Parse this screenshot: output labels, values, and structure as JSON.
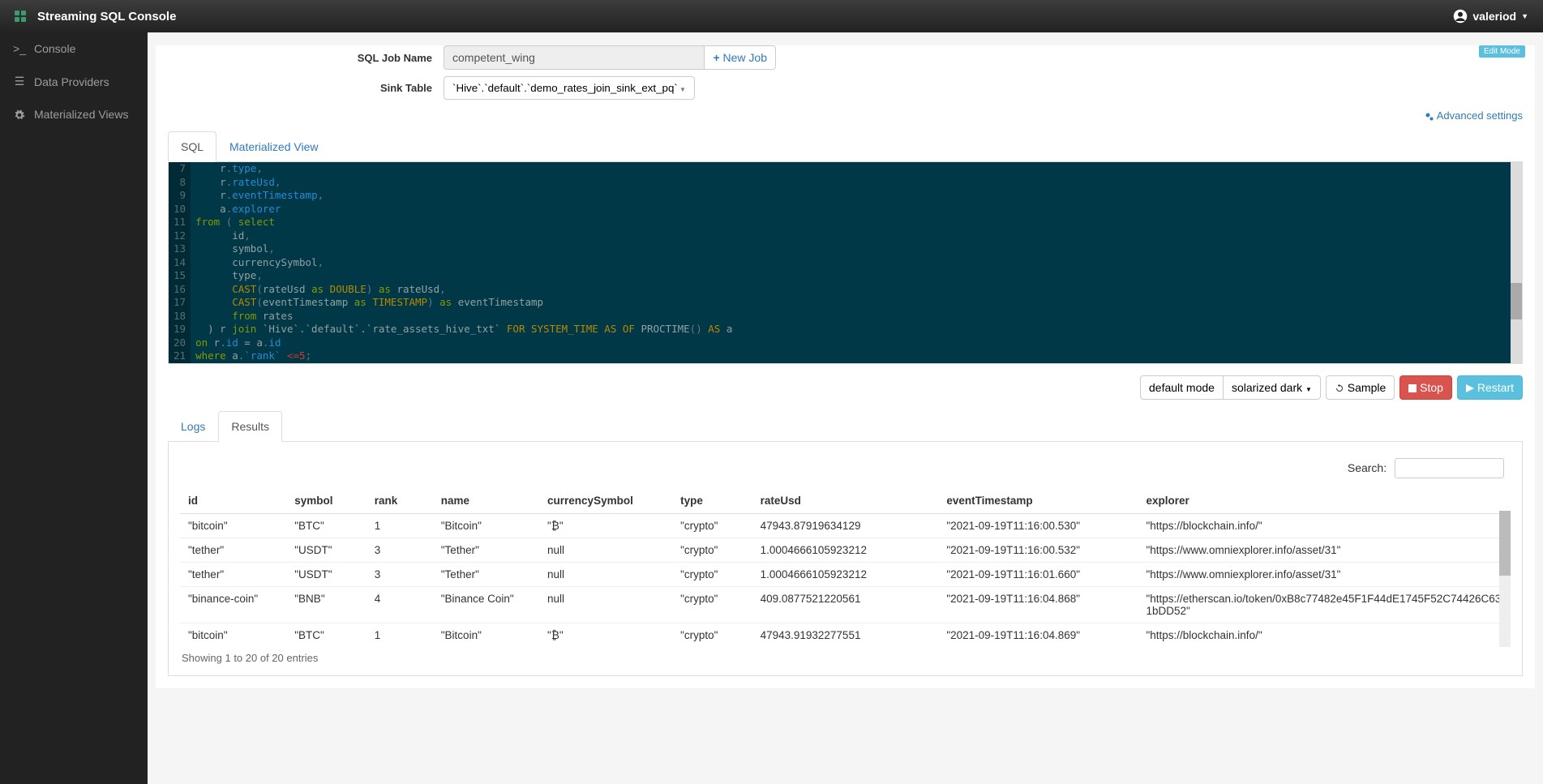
{
  "app": {
    "title": "Streaming SQL Console"
  },
  "user": {
    "name": "valeriod"
  },
  "sidebar": {
    "items": [
      {
        "label": "Console"
      },
      {
        "label": "Data Providers"
      },
      {
        "label": "Materialized Views"
      }
    ]
  },
  "panel": {
    "editModeLabel": "Edit Mode",
    "jobNameLabel": "SQL Job Name",
    "jobNameValue": "competent_wing",
    "newJobLabel": " New Job",
    "sinkTableLabel": "Sink Table",
    "sinkTableValue": "`Hive`.`default`.`demo_rates_join_sink_ext_pq`",
    "advancedLabel": " Advanced settings"
  },
  "tabs1": {
    "sql": "SQL",
    "mv": "Materialized View"
  },
  "editor": {
    "startLine": 7,
    "lines": [
      {
        "tokens": [
          [
            "    r",
            "ident"
          ],
          [
            ".",
            "punct"
          ],
          [
            "type",
            "fn"
          ],
          [
            ",",
            "punct"
          ]
        ]
      },
      {
        "tokens": [
          [
            "    r",
            "ident"
          ],
          [
            ".",
            "punct"
          ],
          [
            "rateUsd",
            "fn"
          ],
          [
            ",",
            "punct"
          ]
        ]
      },
      {
        "tokens": [
          [
            "    r",
            "ident"
          ],
          [
            ".",
            "punct"
          ],
          [
            "eventTimestamp",
            "fn"
          ],
          [
            ",",
            "punct"
          ]
        ]
      },
      {
        "tokens": [
          [
            "    a",
            "ident"
          ],
          [
            ".",
            "punct"
          ],
          [
            "explorer",
            "fn"
          ]
        ]
      },
      {
        "tokens": [
          [
            "from",
            "kw"
          ],
          [
            " ( ",
            "punct"
          ],
          [
            "select",
            "kw"
          ]
        ]
      },
      {
        "tokens": [
          [
            "      id",
            "ident"
          ],
          [
            ",",
            "punct"
          ]
        ]
      },
      {
        "tokens": [
          [
            "      symbol",
            "ident"
          ],
          [
            ",",
            "punct"
          ]
        ]
      },
      {
        "tokens": [
          [
            "      currencySymbol",
            "ident"
          ],
          [
            ",",
            "punct"
          ]
        ]
      },
      {
        "tokens": [
          [
            "      type",
            "ident"
          ],
          [
            ",",
            "punct"
          ]
        ]
      },
      {
        "tokens": [
          [
            "      ",
            "ident"
          ],
          [
            "CAST",
            "type2"
          ],
          [
            "(",
            "punct"
          ],
          [
            "rateUsd ",
            "ident"
          ],
          [
            "as",
            "kw"
          ],
          [
            " ",
            "ident"
          ],
          [
            "DOUBLE",
            "type2"
          ],
          [
            ") ",
            "punct"
          ],
          [
            "as",
            "kw"
          ],
          [
            " rateUsd",
            "ident"
          ],
          [
            ",",
            "punct"
          ]
        ]
      },
      {
        "tokens": [
          [
            "      ",
            "ident"
          ],
          [
            "CAST",
            "type2"
          ],
          [
            "(",
            "punct"
          ],
          [
            "eventTimestamp ",
            "ident"
          ],
          [
            "as",
            "kw"
          ],
          [
            " ",
            "ident"
          ],
          [
            "TIMESTAMP",
            "type2"
          ],
          [
            ") ",
            "punct"
          ],
          [
            "as",
            "kw"
          ],
          [
            " eventTimestamp",
            "ident"
          ]
        ]
      },
      {
        "tokens": [
          [
            "      ",
            "ident"
          ],
          [
            "from",
            "kw"
          ],
          [
            " rates",
            "ident"
          ]
        ]
      },
      {
        "tokens": [
          [
            "  ) r ",
            "ident"
          ],
          [
            "join",
            "kw"
          ],
          [
            " `Hive`.`default`.`rate_assets_hive_txt` ",
            "ident"
          ],
          [
            "FOR SYSTEM_TIME AS OF",
            "type2"
          ],
          [
            " PROCTIME",
            "ident"
          ],
          [
            "() ",
            "punct"
          ],
          [
            "AS",
            "type2"
          ],
          [
            " a",
            "ident"
          ]
        ]
      },
      {
        "tokens": [
          [
            "on",
            "kw"
          ],
          [
            " r",
            "ident"
          ],
          [
            ".",
            "punct"
          ],
          [
            "id",
            "fn"
          ],
          [
            " = a",
            "ident"
          ],
          [
            ".",
            "punct"
          ],
          [
            "id",
            "fn"
          ]
        ]
      },
      {
        "tokens": [
          [
            "where",
            "kw"
          ],
          [
            " a",
            "ident"
          ],
          [
            ".",
            "punct"
          ],
          [
            "`rank`",
            "fn"
          ],
          [
            " ",
            "ident"
          ],
          [
            "<=",
            "op"
          ],
          [
            "5",
            "op"
          ],
          [
            ";",
            "punct"
          ]
        ]
      }
    ]
  },
  "actions": {
    "mode": "default mode",
    "theme": "solarized dark",
    "sample": " Sample",
    "stop": " Stop",
    "restart": " Restart"
  },
  "tabs2": {
    "logs": "Logs",
    "results": "Results"
  },
  "results": {
    "searchLabel": "Search:",
    "columns": [
      "id",
      "symbol",
      "rank",
      "name",
      "currencySymbol",
      "type",
      "rateUsd",
      "eventTimestamp",
      "explorer"
    ],
    "rows": [
      [
        "\"bitcoin\"",
        "\"BTC\"",
        "1",
        "\"Bitcoin\"",
        "\"₿\"",
        "\"crypto\"",
        "47943.87919634129",
        "\"2021-09-19T11:16:00.530\"",
        "\"https://blockchain.info/\""
      ],
      [
        "\"tether\"",
        "\"USDT\"",
        "3",
        "\"Tether\"",
        "null",
        "\"crypto\"",
        "1.0004666105923212",
        "\"2021-09-19T11:16:00.532\"",
        "\"https://www.omniexplorer.info/asset/31\""
      ],
      [
        "\"tether\"",
        "\"USDT\"",
        "3",
        "\"Tether\"",
        "null",
        "\"crypto\"",
        "1.0004666105923212",
        "\"2021-09-19T11:16:01.660\"",
        "\"https://www.omniexplorer.info/asset/31\""
      ],
      [
        "\"binance-coin\"",
        "\"BNB\"",
        "4",
        "\"Binance Coin\"",
        "null",
        "\"crypto\"",
        "409.0877521220561",
        "\"2021-09-19T11:16:04.868\"",
        "\"https://etherscan.io/token/0xB8c77482e45F1F44dE1745F52C74426C631bDD52\""
      ],
      [
        "\"bitcoin\"",
        "\"BTC\"",
        "1",
        "\"Bitcoin\"",
        "\"₿\"",
        "\"crypto\"",
        "47943.91932277551",
        "\"2021-09-19T11:16:04.869\"",
        "\"https://blockchain.info/\""
      ]
    ],
    "footer": "Showing 1 to 20 of 20 entries"
  }
}
